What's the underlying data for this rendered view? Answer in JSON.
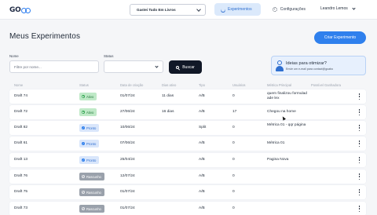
{
  "brand": {
    "logo_text": "GO"
  },
  "header": {
    "project": "Gastei Tudo Em Livros",
    "nav_experiments": "Experimentos",
    "nav_settings": "Configurações",
    "user_name": "Leandro Lemos"
  },
  "page": {
    "title": "Meus Experimentos",
    "create_label": "Criar Experimento"
  },
  "filters": {
    "name_label": "Nome",
    "name_placeholder": "Filtre por nome...",
    "status_label": "Status",
    "status_value": "",
    "search_label": "Buscar"
  },
  "ideas": {
    "title": "Ideias para otimizar?",
    "subtitle": "Envie um e-mail para contact@goabo"
  },
  "table": {
    "headers": [
      "Nome",
      "Status",
      "Data de criação",
      "Dias ativo",
      "Tipo",
      "Usuários",
      "Métrica Principal",
      "Possível Ganhadora"
    ],
    "rows": [
      {
        "name": "Draft 74",
        "status": "Ativo",
        "status_kind": "ativo",
        "created": "01/07/24",
        "days": "11 dias",
        "type": "A/B",
        "users": "0",
        "metric": "quem finalizou formulad ade lex"
      },
      {
        "name": "Draft 72",
        "status": "Ativo",
        "status_kind": "ativo",
        "created": "27/06/24",
        "days": "16 dias",
        "type": "A/B",
        "users": "17",
        "metric": "Chegou na home"
      },
      {
        "name": "Draft 82",
        "status": "Pronto",
        "status_kind": "pronto",
        "created": "10/06/24",
        "days": "",
        "type": "Split",
        "users": "0",
        "metric": "Métrica 01 - qqr página"
      },
      {
        "name": "Draft 61",
        "status": "Pronto",
        "status_kind": "pronto",
        "created": "07/06/24",
        "days": "",
        "type": "A/B",
        "users": "0",
        "metric": "Métrica 01"
      },
      {
        "name": "Draft 13",
        "status": "Pronto",
        "status_kind": "pronto",
        "created": "25/04/24",
        "days": "",
        "type": "A/B",
        "users": "0",
        "metric": "Pagina Nova"
      },
      {
        "name": "Draft 76",
        "status": "Rascunho",
        "status_kind": "rascunho",
        "created": "12/07/24",
        "days": "",
        "type": "A/B",
        "users": "0",
        "metric": ""
      },
      {
        "name": "Draft 75",
        "status": "Rascunho",
        "status_kind": "rascunho",
        "created": "01/07/24",
        "days": "",
        "type": "A/B",
        "users": "0",
        "metric": ""
      },
      {
        "name": "Draft 73",
        "status": "Rascunho",
        "status_kind": "rascunho",
        "created": "01/07/24",
        "days": "",
        "type": "A/B",
        "users": "0",
        "metric": ""
      }
    ]
  },
  "colors": {
    "accent": "#2f80ed",
    "active": "#34a853",
    "draft": "#9aa1ab",
    "dark_button": "#111827"
  },
  "icons": {
    "project": "chevron-down-icon",
    "experiments": "flask-icon",
    "settings": "gear-icon",
    "search": "search-icon",
    "ideas": "person-lightbulb-icon",
    "row_menu": "kebab-menu-icon",
    "status_ativo": "play-icon",
    "status_pronto": "check-icon",
    "status_rascunho": "draft-icon"
  }
}
